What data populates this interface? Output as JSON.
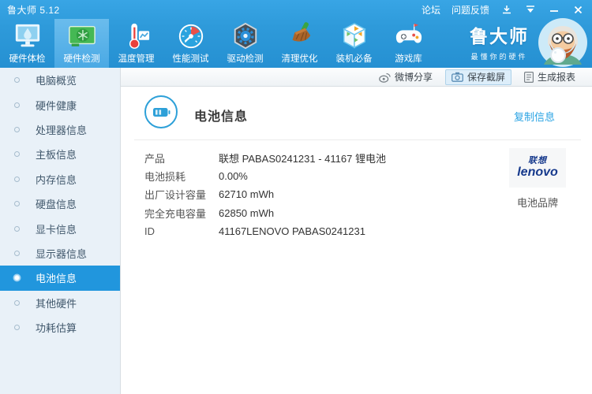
{
  "titlebar": {
    "app_title": "鲁大师 5.12",
    "forum_link": "论坛",
    "feedback_link": "问题反馈",
    "window_controls": [
      "download-icon",
      "skin-icon",
      "minimize-icon",
      "close-icon"
    ]
  },
  "toolbar": {
    "items": [
      {
        "label": "硬件体检",
        "icon": "monitor-drop-icon",
        "active": false
      },
      {
        "label": "硬件检测",
        "icon": "gpu-card-icon",
        "active": true
      },
      {
        "label": "温度管理",
        "icon": "thermometer-chart-icon",
        "active": false
      },
      {
        "label": "性能测试",
        "icon": "gauge-icon",
        "active": false
      },
      {
        "label": "驱动检测",
        "icon": "hex-gear-icon",
        "active": false
      },
      {
        "label": "清理优化",
        "icon": "broom-icon",
        "active": false
      },
      {
        "label": "装机必备",
        "icon": "cube-icon",
        "active": false
      },
      {
        "label": "游戏库",
        "icon": "gamepad-icon",
        "active": false
      }
    ],
    "brand": {
      "name": "鲁大师",
      "tagline": "最懂你的硬件"
    }
  },
  "actionbar": {
    "share_label": "微博分享",
    "screenshot_label": "保存截屏",
    "report_label": "生成报表"
  },
  "sidebar": {
    "items": [
      {
        "label": "电脑概览",
        "selected": false
      },
      {
        "label": "硬件健康",
        "selected": false
      },
      {
        "label": "处理器信息",
        "selected": false
      },
      {
        "label": "主板信息",
        "selected": false
      },
      {
        "label": "内存信息",
        "selected": false
      },
      {
        "label": "硬盘信息",
        "selected": false
      },
      {
        "label": "显卡信息",
        "selected": false
      },
      {
        "label": "显示器信息",
        "selected": false
      },
      {
        "label": "电池信息",
        "selected": true
      },
      {
        "label": "其他硬件",
        "selected": false
      },
      {
        "label": "功耗估算",
        "selected": false
      }
    ]
  },
  "main": {
    "title": "电池信息",
    "copy_link": "复制信息",
    "rows": [
      {
        "label": "产品",
        "value": "联想 PABAS0241231 - 41167 锂电池"
      },
      {
        "label": "电池损耗",
        "value": "0.00%"
      },
      {
        "label": "出厂设计容量",
        "value": "62710 mWh"
      },
      {
        "label": "完全充电容量",
        "value": "62850 mWh"
      },
      {
        "label": "ID",
        "value": "41167LENOVO PABAS0241231"
      }
    ],
    "brand_panel": {
      "logo_cn": "联想",
      "logo_en": "lenovo",
      "caption": "电池品牌"
    }
  },
  "colors": {
    "titlebar_blue": "#2e9ada",
    "active_sidebar_blue": "#2196dd",
    "link_blue": "#2aa3e3",
    "lenovo_blue": "#16398c",
    "sidebar_bg": "#e9f1f8"
  }
}
